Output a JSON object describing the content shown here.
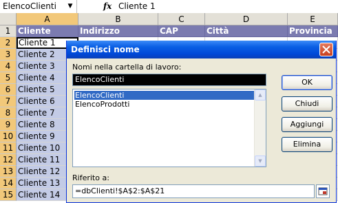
{
  "formula_bar": {
    "name_box": "ElencoClienti",
    "fx_label": "fx",
    "value": "Cliente 1"
  },
  "columns": [
    {
      "label": "A",
      "selected": true
    },
    {
      "label": "B",
      "selected": false
    },
    {
      "label": "C",
      "selected": false
    },
    {
      "label": "D",
      "selected": false
    },
    {
      "label": "E",
      "selected": false
    }
  ],
  "sheet": {
    "header_row": {
      "number": "1",
      "cells": [
        "Cliente",
        "Indirizzo",
        "CAP",
        "Città",
        "Provincia"
      ]
    },
    "rows": [
      {
        "number": "2",
        "value": "Cliente 1"
      },
      {
        "number": "3",
        "value": "Cliente 2"
      },
      {
        "number": "4",
        "value": "Cliente 3"
      },
      {
        "number": "5",
        "value": "Cliente 4"
      },
      {
        "number": "6",
        "value": "Cliente 5"
      },
      {
        "number": "7",
        "value": "Cliente 6"
      },
      {
        "number": "8",
        "value": "Cliente 7"
      },
      {
        "number": "9",
        "value": "Cliente 8"
      },
      {
        "number": "10",
        "value": "Cliente 9"
      },
      {
        "number": "11",
        "value": "Cliente 10"
      },
      {
        "number": "12",
        "value": "Cliente 11"
      },
      {
        "number": "13",
        "value": "Cliente 12"
      },
      {
        "number": "14",
        "value": "Cliente 13"
      },
      {
        "number": "15",
        "value": "Cliente 14"
      }
    ]
  },
  "dialog": {
    "title": "Definisci nome",
    "names_label": "Nomi nella cartella di lavoro:",
    "name_input_value": "ElencoClienti",
    "names": [
      "ElencoClienti",
      "ElencoProdotti"
    ],
    "selected_name": "ElencoClienti",
    "buttons": {
      "ok": "OK",
      "close": "Chiudi",
      "add": "Aggiungi",
      "delete": "Elimina"
    },
    "ref_label": "Riferito a:",
    "ref_value": "=dbClienti!$A$2:$A$21"
  },
  "colors": {
    "header_fill": "#7b7bb0",
    "selection_fill": "#c3cbe6",
    "titlebar": "#0a5fe4",
    "list_selection": "#316ac5"
  }
}
